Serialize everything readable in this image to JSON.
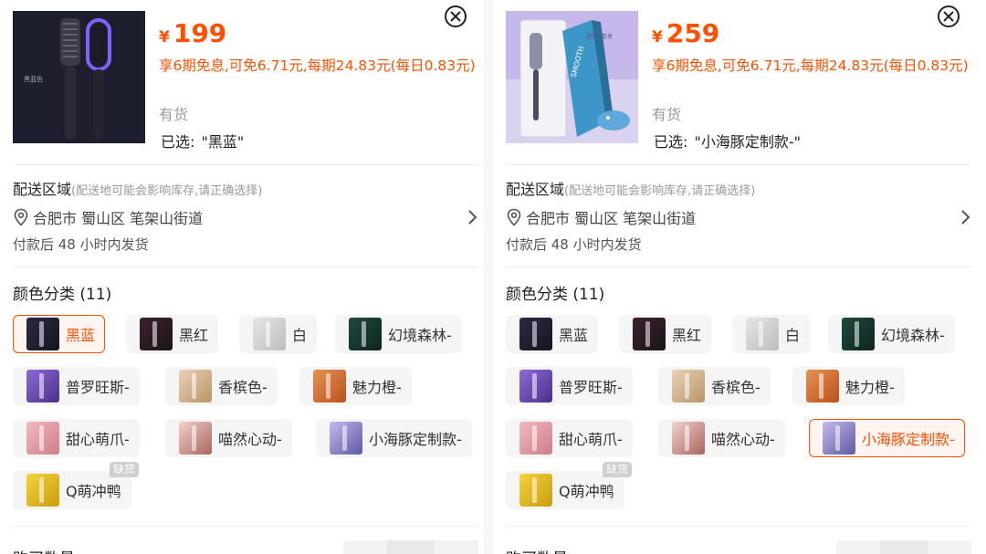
{
  "colors": {
    "accent": "#ff5000",
    "muted": "#999999"
  },
  "shared": {
    "ship_title": "配送区域",
    "ship_note": "(配送地可能会影响库存,请正确选择)",
    "address": "合肥市 蜀山区 笔架山街道",
    "dispatch": "付款后 48 小时内发货",
    "color_title": "颜色分类 (11)",
    "stock": "有货",
    "selected_prefix": "已选:",
    "qty_label": "购买数量",
    "oos_badge": "缺货",
    "icons": [
      "close-icon",
      "location-pin-icon",
      "chevron-right-icon"
    ]
  },
  "panels": [
    {
      "currency": "¥",
      "price": "199",
      "installment": "享6期免息,可免6.71元,每期24.83元(每日0.83元)",
      "selected_value": "\"黑蓝\"",
      "options": [
        "黑蓝",
        "黑红",
        "白",
        "幻境森林-",
        "普罗旺斯-",
        "香槟色-",
        "魅力橙-",
        "甜心萌爪-",
        "喵然心动-",
        "小海豚定制款-",
        "Q萌冲鸭"
      ],
      "active_index": 0
    },
    {
      "currency": "¥",
      "price": "259",
      "installment": "享6期免息,可免6.71元,每期24.83元(每日0.83元)",
      "selected_value": "\"小海豚定制款-\"",
      "options": [
        "黑蓝",
        "黑红",
        "白",
        "幻境森林-",
        "普罗旺斯-",
        "香槟色-",
        "魅力橙-",
        "甜心萌爪-",
        "喵然心动-",
        "小海豚定制款-",
        "Q萌冲鸭"
      ],
      "active_index": 9
    }
  ]
}
